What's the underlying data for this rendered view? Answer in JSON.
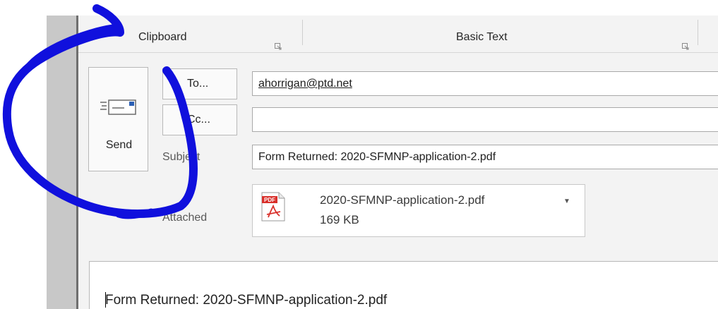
{
  "ribbon": {
    "groups": [
      {
        "label": "Clipboard"
      },
      {
        "label": "Basic Text"
      }
    ]
  },
  "compose": {
    "send_label": "Send",
    "to_button": "To...",
    "cc_button": "Cc...",
    "to_value": "ahorrigan@ptd.net",
    "cc_value": "",
    "subject_label": "Subject",
    "subject_value": "Form Returned: 2020-SFMNP-application-2.pdf",
    "attached_label": "Attached",
    "attachment": {
      "icon_text": "PDF",
      "filename": "2020-SFMNP-application-2.pdf",
      "size": "169 KB"
    },
    "body_text": "Form Returned: 2020-SFMNP-application-2.pdf"
  },
  "colors": {
    "annotation_stroke": "#1010dd",
    "pdf_red": "#d9302b"
  },
  "icons": {
    "send": "envelope-send-icon",
    "attachment": "pdf-file-icon",
    "dialog_launcher": "dialog-launcher-icon",
    "dropdown": "chevron-down-icon"
  }
}
